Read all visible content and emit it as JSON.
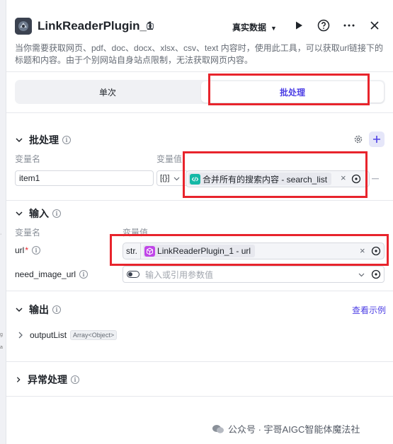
{
  "header": {
    "title": "LinkReaderPlugin_1",
    "data_select": "真实数据",
    "icons": [
      "plugin-logo-icon",
      "run-play-icon",
      "help-icon",
      "more-icon",
      "close-icon"
    ],
    "description": "当你需要获取网页、pdf、doc、docx、xlsx、csv、text 内容时，使用此工具，可以获取url链接下的标题和内容。由于个别网站自身站点限制，无法获取网页内容。"
  },
  "tabs": [
    {
      "label": "单次",
      "active": false
    },
    {
      "label": "批处理",
      "active": true
    }
  ],
  "batch": {
    "title": "批处理",
    "col_name": "变量名",
    "col_value": "变量值",
    "row": {
      "name": "item1",
      "type": "[{}]",
      "ref_label": "合并所有的搜索内容 - search_list"
    }
  },
  "inputs": {
    "title": "输入",
    "col_name": "变量名",
    "col_value": "变量值",
    "rows": [
      {
        "label": "url",
        "required": true,
        "type": "str.",
        "ref_label": "LinkReaderPlugin_1 - url"
      },
      {
        "label": "need_image_url",
        "required": false,
        "placeholder": "输入或引用参数值"
      }
    ]
  },
  "output": {
    "title": "输出",
    "example_link": "查看示例",
    "item_name": "outputList",
    "item_type": "Array<Object>"
  },
  "exception": {
    "title": "异常处理"
  },
  "watermark": "公众号 · 宇哥AIGC智能体魔法社",
  "colors": {
    "accent": "#4e40e5",
    "highlight_box": "#e8242c",
    "code_tag": "#14b8a6",
    "plugin_tag": "#c046e8"
  }
}
